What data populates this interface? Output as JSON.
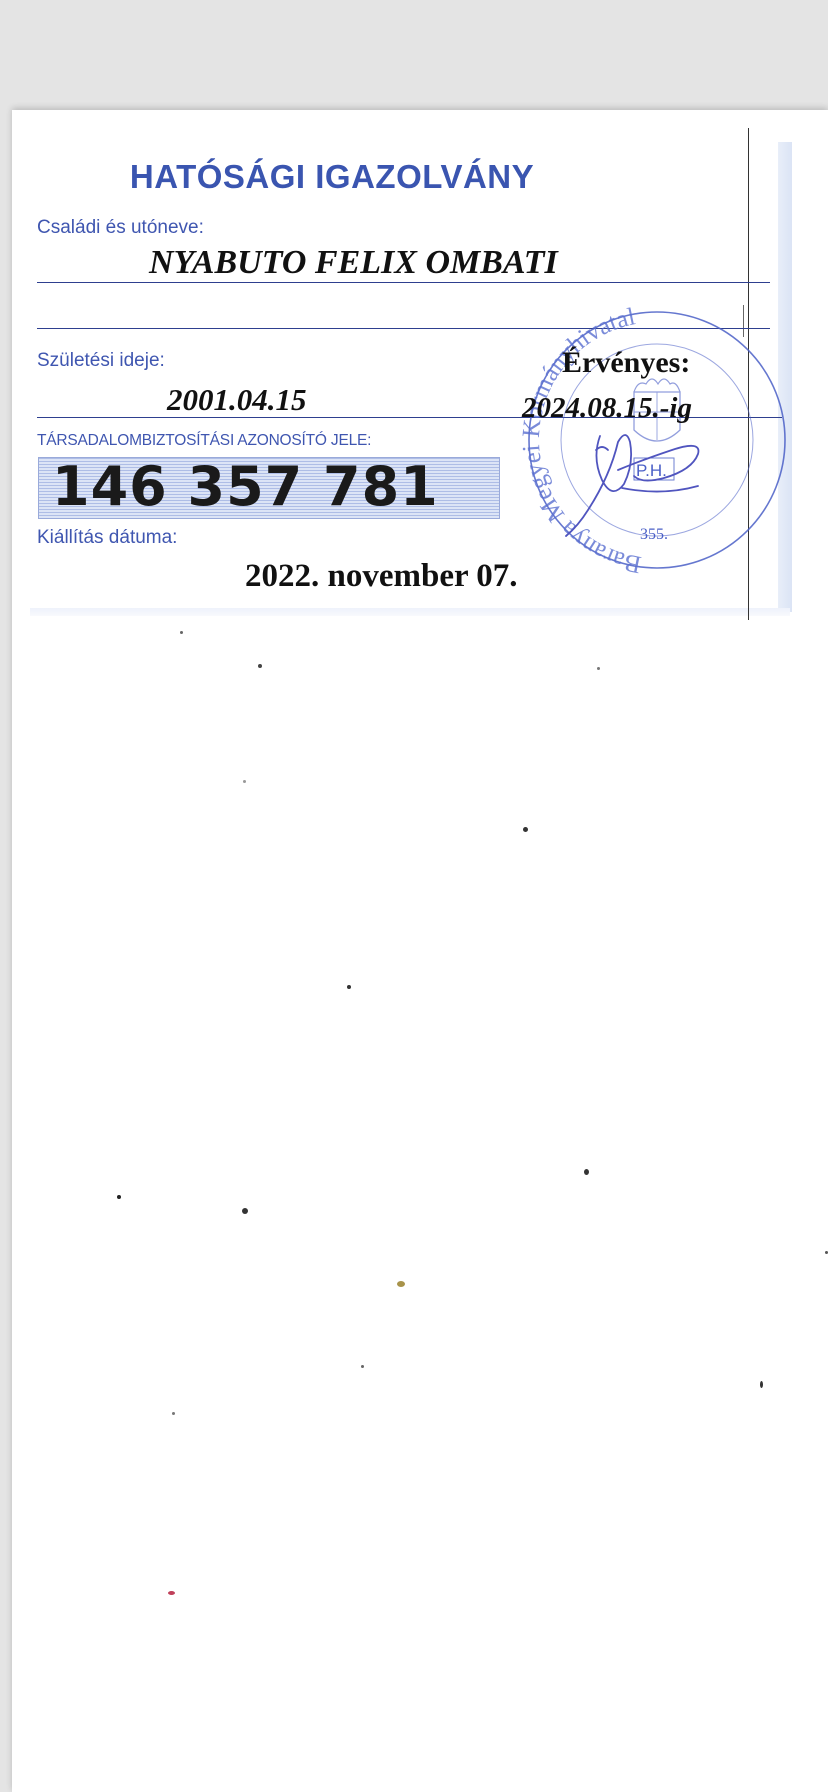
{
  "document": {
    "title": "HATÓSÁGI IGAZOLVÁNY",
    "name_label": "Családi és utóneve:",
    "name_value": "NYABUTO FELIX OMBATI",
    "birth_label": "Születési ideje:",
    "birth_value": "2001.04.15",
    "ssn_label": "TÁRSADALOMBIZTOSÍTÁSI AZONOSÍTÓ JELE:",
    "ssn_value": "146 357 781",
    "issue_label": "Kiállítás dátuma:",
    "issue_value": "2022. november 07.",
    "valid_label": "Érvényes:",
    "valid_value": "2024.08.15.-ig"
  },
  "stamp": {
    "ring_text": "Baranya Megyei Kormányhivatal",
    "center_text": "P.H.",
    "number": "355."
  },
  "colors": {
    "print_blue": "#3f56b0",
    "stamp_blue": "#4a5fc7",
    "ink": "#111111"
  }
}
